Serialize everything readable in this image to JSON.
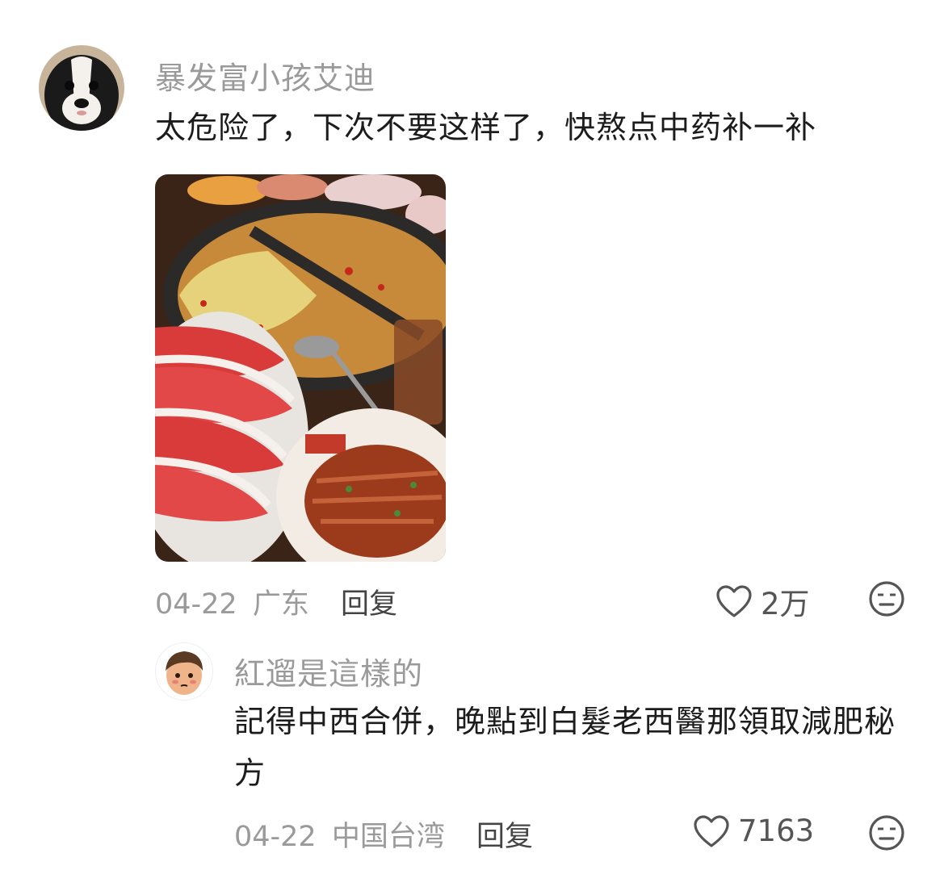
{
  "comments": [
    {
      "username": "暴发富小孩艾迪",
      "text": "太危险了，下次不要这样了，快熬点中药补一补",
      "date": "04-22",
      "location": "广东",
      "reply_label": "回复",
      "likes": "2万",
      "avatar_icon": "dog-avatar",
      "has_image": true
    },
    {
      "username": "紅遛是這樣的",
      "text": "記得中西合併，晚點到白髮老西醫那領取減肥秘方",
      "date": "04-22",
      "location": "中国台湾",
      "reply_label": "回复",
      "likes": "7163",
      "avatar_icon": "cartoon-boy-avatar",
      "has_image": false
    }
  ],
  "colors": {
    "username": "#9a9a9a",
    "text": "#1c1c1c",
    "meta": "#9a9a9a",
    "icon": "#555555"
  }
}
